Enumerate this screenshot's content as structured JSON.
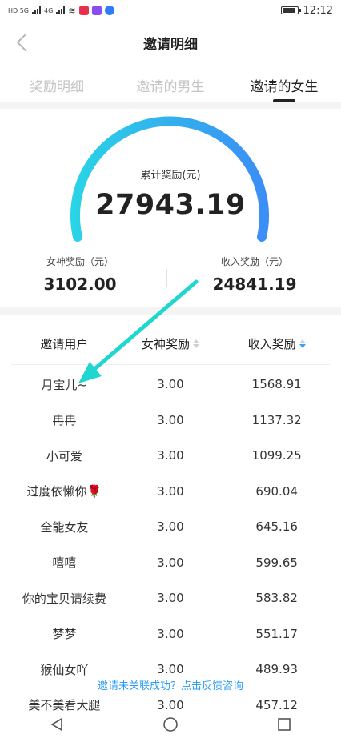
{
  "status_bar": {
    "signal1": "HD 5G",
    "signal2": "4G",
    "time": "12:12"
  },
  "nav": {
    "title": "邀请明细",
    "back_icon": "chevron-left-icon"
  },
  "tabs": [
    {
      "label": "奖励明细",
      "active": false
    },
    {
      "label": "邀请的男生",
      "active": false
    },
    {
      "label": "邀请的女生",
      "active": true
    }
  ],
  "gauge": {
    "label": "累计奖励(元)",
    "value": "27943.19",
    "gradient_start": "#2ad3e6",
    "gradient_end": "#3b8ef5"
  },
  "summary": {
    "left_label": "女神奖励（元）",
    "left_value": "3102.00",
    "right_label": "收入奖励（元）",
    "right_value": "24841.19"
  },
  "table": {
    "headers": [
      "邀请用户",
      "女神奖励",
      "收入奖励"
    ],
    "sorted_column": "收入奖励",
    "sort_direction": "descending",
    "rows": [
      [
        "月宝儿~",
        "3.00",
        "1568.91"
      ],
      [
        "冉冉",
        "3.00",
        "1137.32"
      ],
      [
        "小可爱",
        "3.00",
        "1099.25"
      ],
      [
        "过度依懒你🌹",
        "3.00",
        "690.04"
      ],
      [
        "全能女友",
        "3.00",
        "645.16"
      ],
      [
        "嘻嘻",
        "3.00",
        "599.65"
      ],
      [
        "你的宝贝请续费",
        "3.00",
        "583.82"
      ],
      [
        "梦梦",
        "3.00",
        "551.17"
      ],
      [
        "猴仙女吖",
        "3.00",
        "489.93"
      ],
      [
        "美不美看大腿",
        "3.00",
        "457.12"
      ]
    ]
  },
  "feedback_link": "邀请未关联成功？点击反馈咨询",
  "annotation_color": "#1fd6d0",
  "accent_color": "#2a9df4"
}
